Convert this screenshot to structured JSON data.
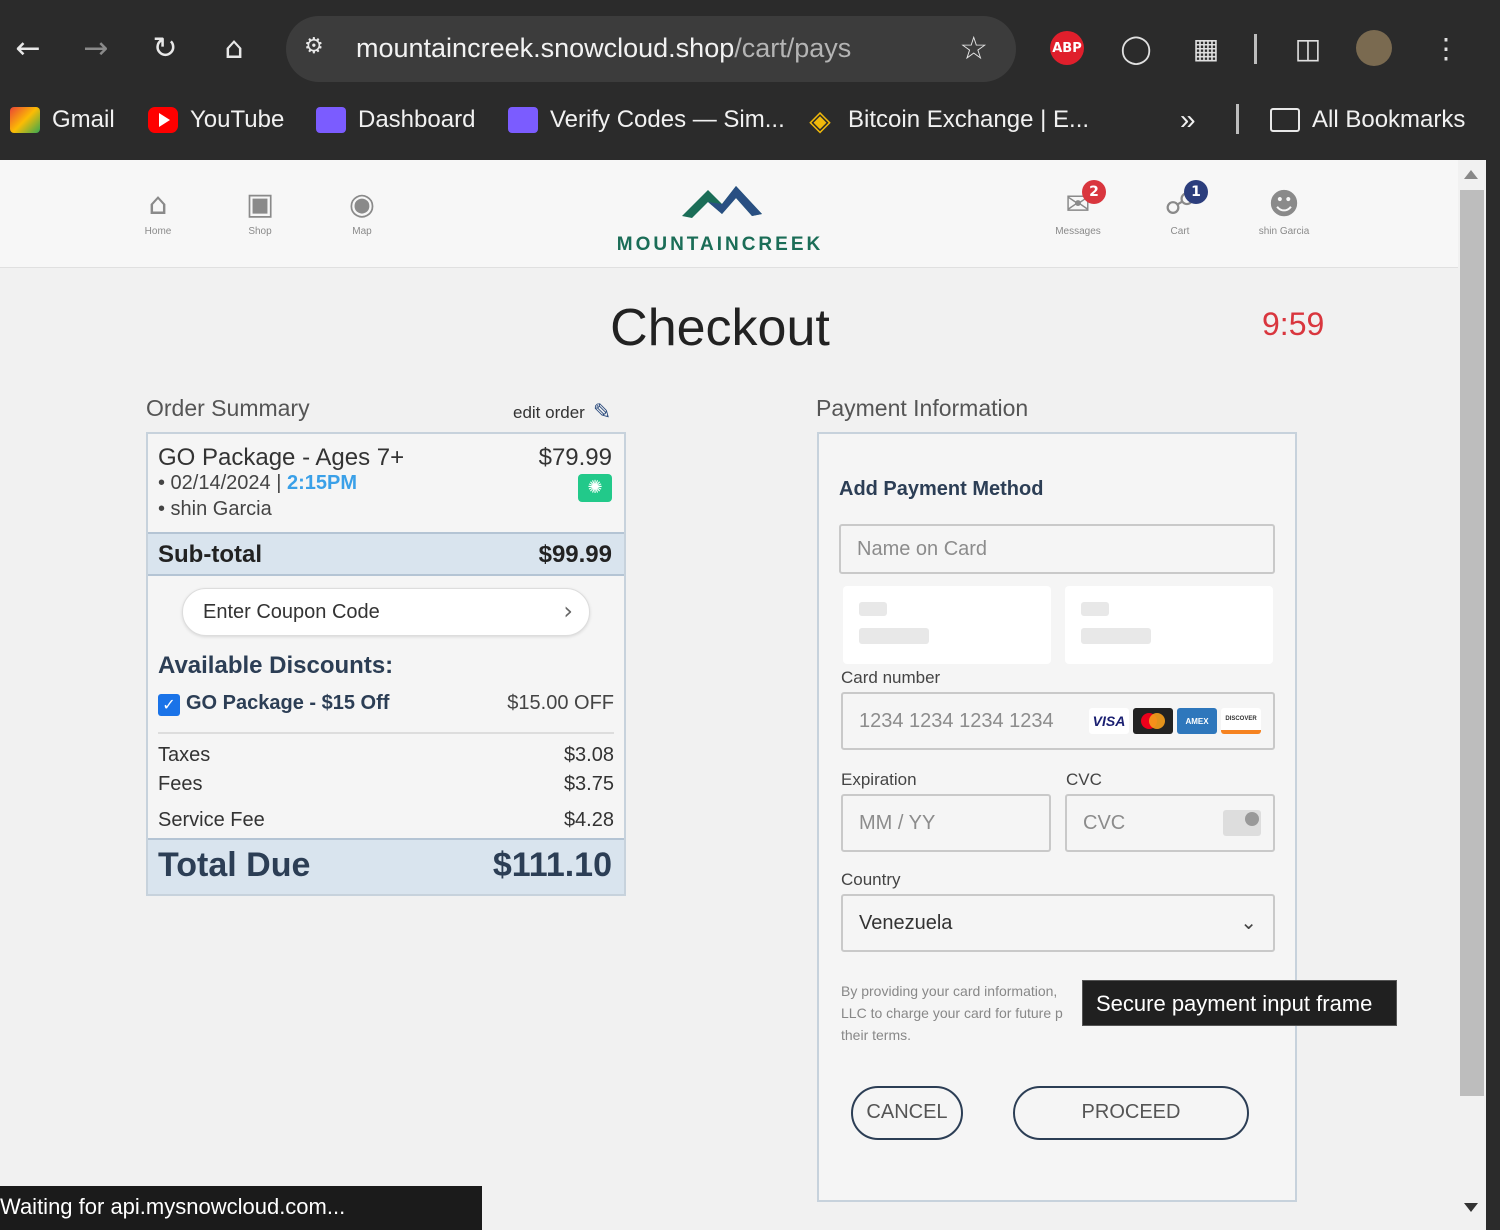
{
  "browser": {
    "url_host": "mountaincreek.snowcloud.shop",
    "url_path": "/cart/pays",
    "extensions": {
      "abp_label": "ABP"
    },
    "bookmarks": [
      {
        "label": "Gmail",
        "icon": "gmail-icon"
      },
      {
        "label": "YouTube",
        "icon": "youtube-icon"
      },
      {
        "label": "Dashboard",
        "icon": "dashboard-icon"
      },
      {
        "label": "Verify Codes — Sim...",
        "icon": "verify-icon"
      },
      {
        "label": "Bitcoin Exchange | E...",
        "icon": "binance-icon"
      }
    ],
    "all_bookmarks_label": "All Bookmarks",
    "overflow_label": "»"
  },
  "site": {
    "logo_text": "MOUNTAINCREEK",
    "nav": [
      {
        "label": "Home",
        "icon": "home-icon"
      },
      {
        "label": "Shop",
        "icon": "shop-icon"
      },
      {
        "label": "Map",
        "icon": "map-pin-icon"
      }
    ],
    "right_nav": {
      "messages_label": "Messages",
      "messages_count": "2",
      "cart_label": "Cart",
      "cart_count": "1",
      "user_label": "shin Garcia"
    }
  },
  "checkout": {
    "title": "Checkout",
    "timer": "9:59"
  },
  "order_summary": {
    "title": "Order Summary",
    "edit_label": "edit order",
    "item": {
      "name": "GO Package - Ages 7+",
      "price": "$79.99",
      "date_prefix": "• 02/14/2024 | ",
      "time": "2:15PM",
      "guest": "• shin Garcia"
    },
    "subtotal_label": "Sub-total",
    "subtotal_value": "$99.99",
    "coupon_label": "Enter Coupon Code",
    "discounts_title": "Available Discounts:",
    "discount": {
      "name": "GO Package - $15 Off",
      "value": "$15.00 OFF",
      "checked": true
    },
    "fees": [
      {
        "label": "Taxes",
        "value": "$3.08"
      },
      {
        "label": "Fees",
        "value": "$3.75"
      },
      {
        "label": "Service Fee",
        "value": "$4.28"
      }
    ],
    "total_label": "Total Due",
    "total_value": "$111.10"
  },
  "payment": {
    "title": "Payment Information",
    "section_title": "Add Payment Method",
    "name_placeholder": "Name on Card",
    "card_number_label": "Card number",
    "card_number_placeholder": "1234 1234 1234 1234",
    "card_brands": [
      "VISA",
      "Mastercard",
      "AMEX",
      "DISCOVER"
    ],
    "expiration_label": "Expiration",
    "expiration_placeholder": "MM / YY",
    "cvc_label": "CVC",
    "cvc_placeholder": "CVC",
    "country_label": "Country",
    "country_value": "Venezuela",
    "legal_lines": [
      "By providing your card information,",
      "LLC to charge your card for future p",
      "their terms."
    ],
    "tooltip": "Secure payment input frame",
    "cancel_label": "CANCEL",
    "proceed_label": "PROCEED"
  },
  "status_bar": "Waiting for api.mysnowcloud.com...",
  "colors": {
    "accent_blue": "#3aa0e8",
    "navy": "#2c3e55",
    "timer_red": "#d9363e",
    "logo_green": "#1b6d57"
  }
}
